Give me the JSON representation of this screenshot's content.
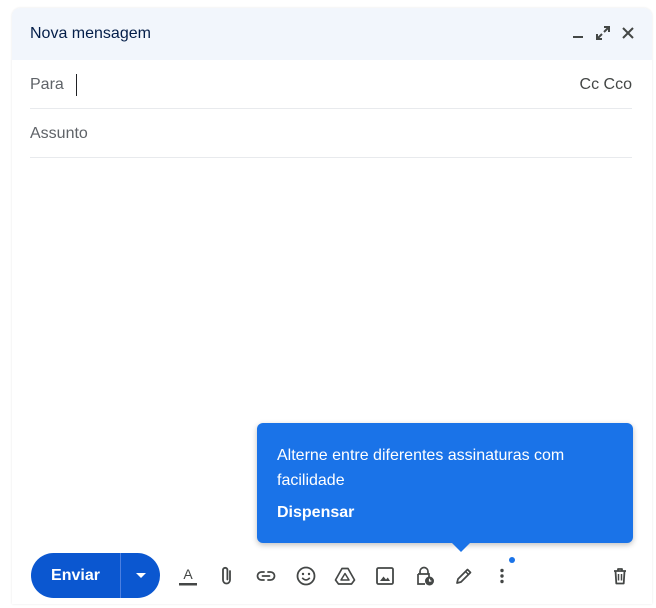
{
  "window": {
    "title": "Nova mensagem"
  },
  "fields": {
    "to_label": "Para",
    "cc_label": "Cc",
    "bcc_label": "Cco",
    "subject_placeholder": "Assunto"
  },
  "tooltip": {
    "text": "Alterne entre diferentes assinaturas com facilidade",
    "dismiss_label": "Dispensar"
  },
  "toolbar": {
    "send_label": "Enviar",
    "icons": [
      "text-format-icon",
      "attach-icon",
      "link-icon",
      "emoji-icon",
      "drive-icon",
      "image-icon",
      "confidential-mode-icon",
      "signature-icon",
      "more-options-icon",
      "delete-icon"
    ]
  },
  "colors": {
    "header_bg": "#f2f6fc",
    "title_text": "#041e49",
    "send_button": "#0b57d0",
    "tooltip_bg": "#1a73e8",
    "icon": "#444746"
  }
}
